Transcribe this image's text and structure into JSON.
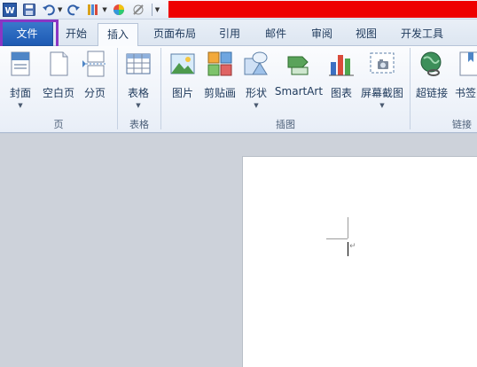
{
  "app": {
    "logo_letter": "W"
  },
  "tabs": [
    {
      "label": "文件"
    },
    {
      "label": "开始"
    },
    {
      "label": "插入"
    },
    {
      "label": "页面布局"
    },
    {
      "label": "引用"
    },
    {
      "label": "邮件"
    },
    {
      "label": "审阅"
    },
    {
      "label": "视图"
    },
    {
      "label": "开发工具"
    }
  ],
  "ribbon": {
    "buttons": [
      {
        "label": "封面",
        "icon": "cover-page-icon",
        "has_dropdown": true
      },
      {
        "label": "空白页",
        "icon": "blank-page-icon",
        "has_dropdown": false
      },
      {
        "label": "分页",
        "icon": "page-break-icon",
        "has_dropdown": false
      },
      {
        "label": "表格",
        "icon": "table-icon",
        "has_dropdown": true
      },
      {
        "label": "图片",
        "icon": "picture-icon",
        "has_dropdown": false
      },
      {
        "label": "剪贴画",
        "icon": "clip-art-icon",
        "has_dropdown": false
      },
      {
        "label": "形状",
        "icon": "shapes-icon",
        "has_dropdown": true
      },
      {
        "label": "SmartArt",
        "icon": "smartart-icon",
        "has_dropdown": false
      },
      {
        "label": "图表",
        "icon": "chart-icon",
        "has_dropdown": false
      },
      {
        "label": "屏幕截图",
        "icon": "screenshot-icon",
        "has_dropdown": true
      },
      {
        "label": "超链接",
        "icon": "hyperlink-icon",
        "has_dropdown": false
      },
      {
        "label": "书签",
        "icon": "bookmark-icon",
        "has_dropdown": false
      }
    ],
    "groups": [
      {
        "label": "页"
      },
      {
        "label": "表格"
      },
      {
        "label": "插图"
      },
      {
        "label": "链接"
      }
    ]
  },
  "document": {
    "paragraph_mark": "↵"
  },
  "colors": {
    "file_tab": "#2a68c0",
    "highlight_box": "#8a36c4",
    "title_bar_red": "#ee0000"
  }
}
